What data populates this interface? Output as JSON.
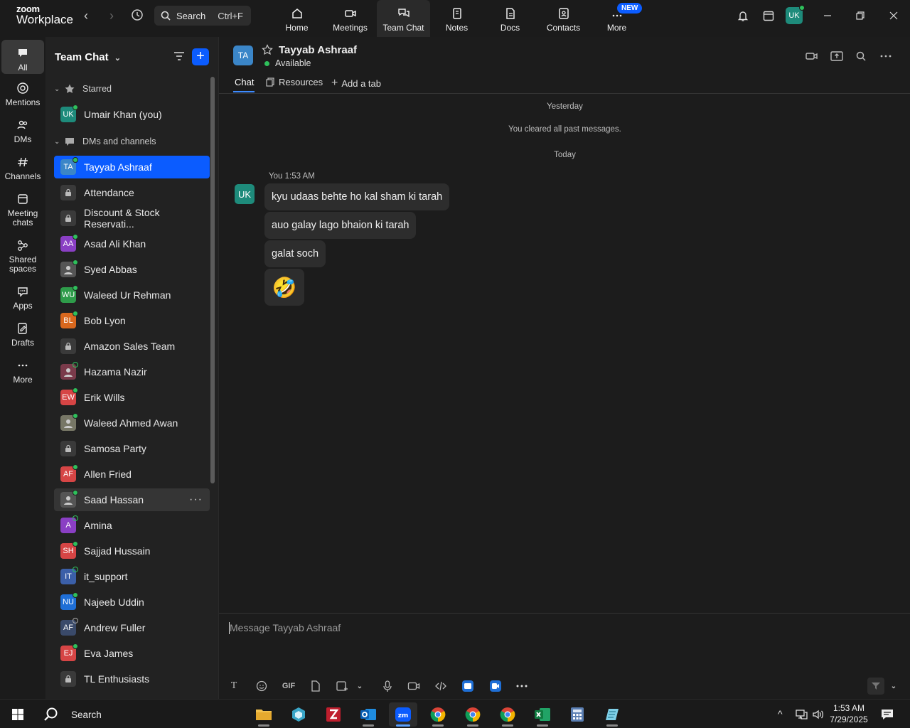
{
  "app": {
    "logo_line1": "zoom",
    "logo_line2": "Workplace",
    "search_placeholder": "Search",
    "search_shortcut": "Ctrl+F"
  },
  "topnav": [
    {
      "label": "Home"
    },
    {
      "label": "Meetings"
    },
    {
      "label": "Team Chat"
    },
    {
      "label": "Notes"
    },
    {
      "label": "Docs"
    },
    {
      "label": "Contacts"
    },
    {
      "label": "More",
      "badge": "NEW"
    }
  ],
  "user_avatar": "UK",
  "rail": [
    {
      "label": "All"
    },
    {
      "label": "Mentions"
    },
    {
      "label": "DMs"
    },
    {
      "label": "Channels"
    },
    {
      "label": "Meeting chats"
    },
    {
      "label": "Shared spaces"
    },
    {
      "label": "Apps"
    },
    {
      "label": "Drafts"
    },
    {
      "label": "More"
    }
  ],
  "sidebar": {
    "title": "Team Chat",
    "starred_label": "Starred",
    "starred": [
      {
        "initials": "UK",
        "name": "Umair Khan (you)",
        "color": "#1e8b7b"
      }
    ],
    "dms_label": "DMs and channels",
    "items": [
      {
        "initials": "TA",
        "name": "Tayyab Ashraaf",
        "color": "#3b86c8"
      },
      {
        "initials": "",
        "name": "Attendance",
        "color": "#3a3a3a"
      },
      {
        "initials": "",
        "name": "Discount & Stock Reservati...",
        "color": "#3a3a3a"
      },
      {
        "initials": "AA",
        "name": "Asad Ali Khan",
        "color": "#8a3fc4"
      },
      {
        "initials": "",
        "name": "Syed Abbas",
        "color": "#555"
      },
      {
        "initials": "WU",
        "name": "Waleed Ur Rehman",
        "color": "#2e9c4a"
      },
      {
        "initials": "BL",
        "name": "Bob Lyon",
        "color": "#d9681e"
      },
      {
        "initials": "",
        "name": "Amazon Sales Team",
        "color": "#3a3a3a"
      },
      {
        "initials": "",
        "name": "Hazama Nazir",
        "color": "#7a3a4a"
      },
      {
        "initials": "EW",
        "name": "Erik Wills",
        "color": "#d64545"
      },
      {
        "initials": "",
        "name": "Waleed Ahmed Awan",
        "color": "#776"
      },
      {
        "initials": "",
        "name": "Samosa Party",
        "color": "#3a3a3a"
      },
      {
        "initials": "AF",
        "name": "Allen Fried",
        "color": "#d64545"
      },
      {
        "initials": "",
        "name": "Saad Hassan",
        "color": "#555"
      },
      {
        "initials": "A",
        "name": "Amina",
        "color": "#8a3fc4"
      },
      {
        "initials": "SH",
        "name": "Sajjad Hussain",
        "color": "#d64545"
      },
      {
        "initials": "IT",
        "name": "it_support",
        "color": "#3b5fa8"
      },
      {
        "initials": "NU",
        "name": "Najeeb Uddin",
        "color": "#1f6fd6"
      },
      {
        "initials": "AF",
        "name": "Andrew Fuller",
        "color": "#3a4a6a"
      },
      {
        "initials": "EJ",
        "name": "Eva James",
        "color": "#d64545"
      },
      {
        "initials": "",
        "name": "TL Enthusiasts",
        "color": "#3a3a3a"
      }
    ]
  },
  "chat": {
    "contact_initials": "TA",
    "contact_name": "Tayyab Ashraaf",
    "status": "Available",
    "tabs": [
      "Chat",
      "Resources",
      "Add a tab"
    ],
    "sys1": "Yesterday",
    "sys2": "You cleared all past messages.",
    "sys3": "Today",
    "sender": "You",
    "time": "1:53 AM",
    "sender_initials": "UK",
    "messages": [
      "kyu udaas behte ho kal sham ki tarah",
      "auo galay lago bhaion ki tarah",
      "galat soch"
    ],
    "emoji": "🤣",
    "composer_placeholder": "Message Tayyab Ashraaf",
    "gif_label": "GIF"
  },
  "taskbar": {
    "search": "Search",
    "time": "1:53 AM",
    "date": "7/29/2025"
  }
}
